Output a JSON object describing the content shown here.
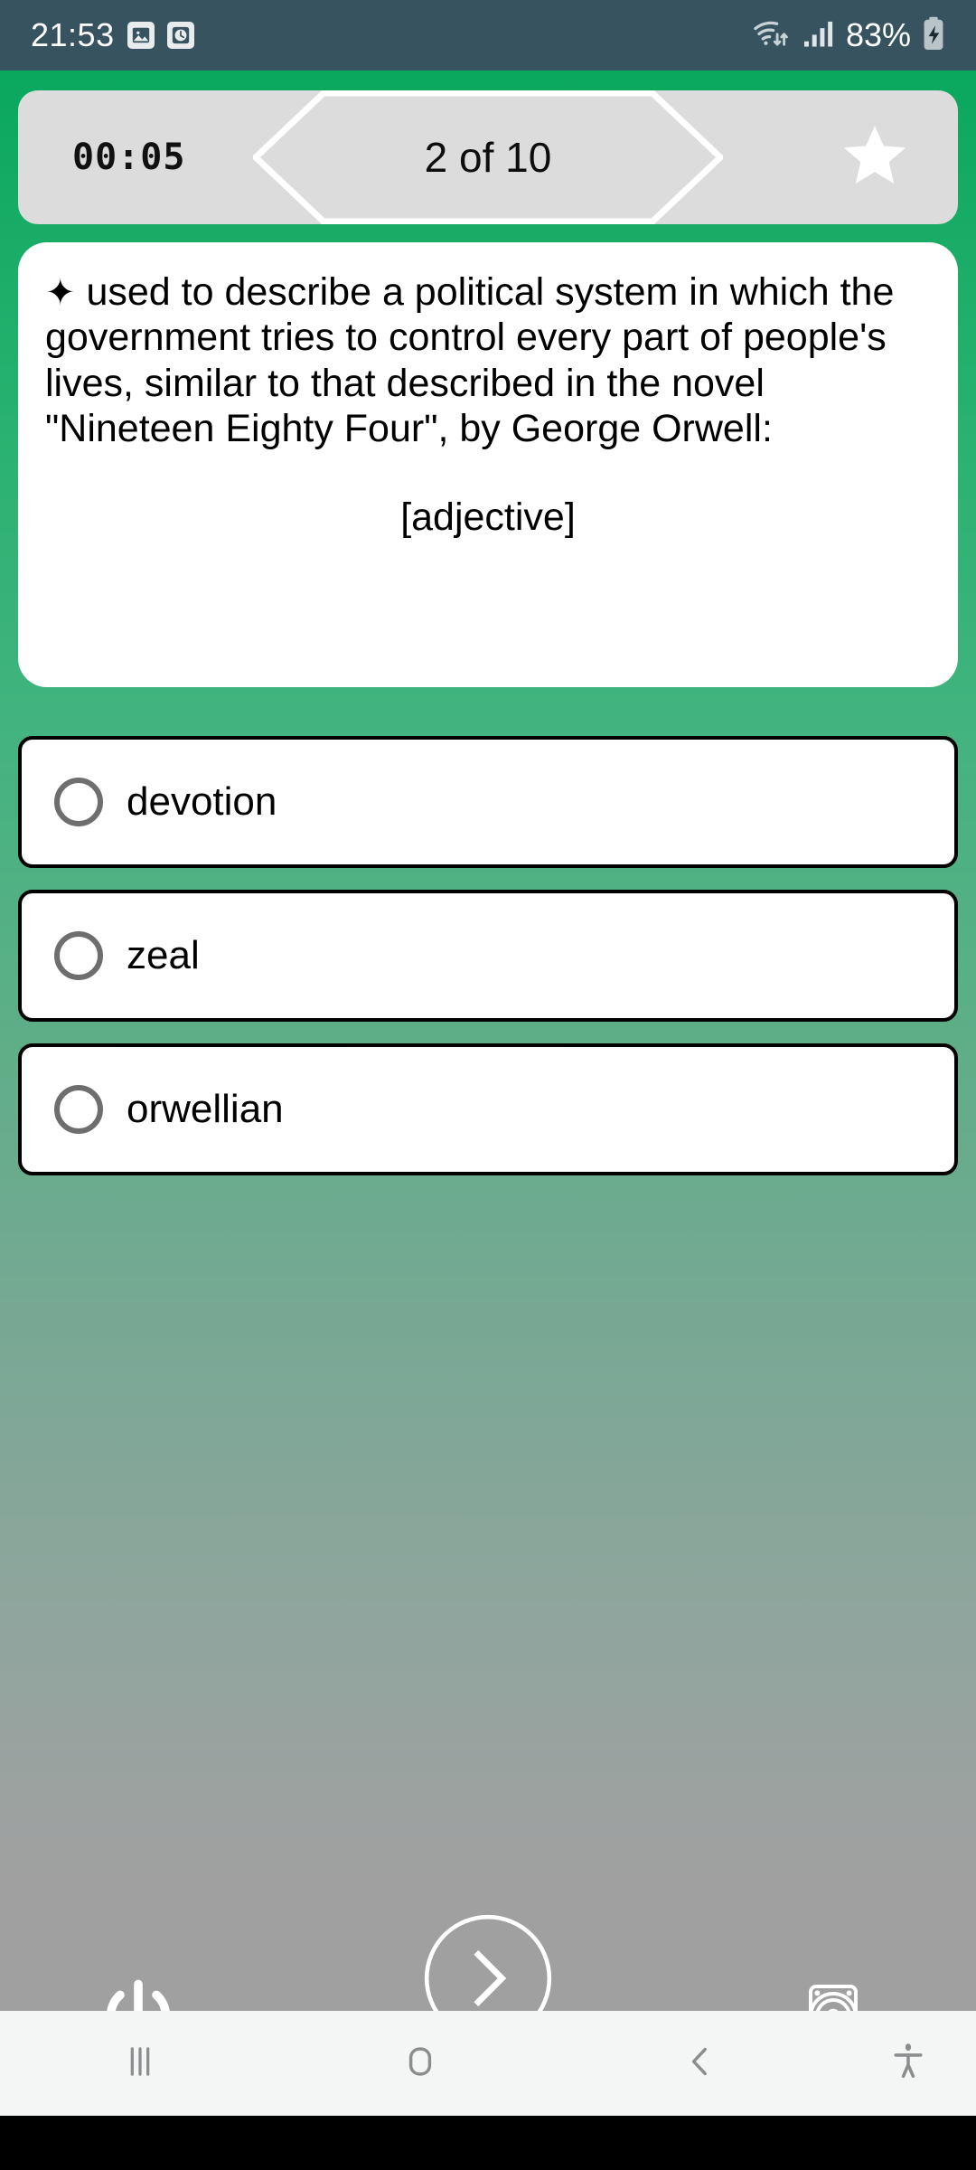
{
  "status_bar": {
    "time": "21:53",
    "battery_text": "83%",
    "icons": [
      "gallery-icon",
      "alarm-clock-icon",
      "wifi-icon",
      "signal-bars-icon",
      "battery-charging-icon"
    ],
    "background_color": "#375360",
    "foreground_color": "#ffffff"
  },
  "theme": {
    "accent_green": "#0aa75e",
    "gradient_end_gray": "#a0a0a0",
    "header_gray": "#dcdcdc",
    "card_white": "#ffffff",
    "radio_gray": "#6e6e6e"
  },
  "header": {
    "timer": "00:05",
    "progress_label": "2 of 10",
    "favorite_icon": "star-icon",
    "favorite_active": true
  },
  "question": {
    "bullet": "✦",
    "text": "used to describe a political system in which the government tries to control every part of people's lives, similar to that described in the novel \"Nineteen Eighty Four\", by George Orwell:",
    "part_of_speech": "[adjective]"
  },
  "options": [
    {
      "label": "devotion",
      "selected": false
    },
    {
      "label": "zeal",
      "selected": false
    },
    {
      "label": "orwellian",
      "selected": false
    }
  ],
  "bottom_controls": [
    {
      "name": "power-icon",
      "label": "Power"
    },
    {
      "name": "next-icon",
      "label": "Next"
    },
    {
      "name": "speaker-icon",
      "label": "Sound"
    }
  ],
  "nav_bar": {
    "recents_label": "Recents",
    "home_label": "Home",
    "back_label": "Back",
    "accessibility_label": "Accessibility"
  }
}
